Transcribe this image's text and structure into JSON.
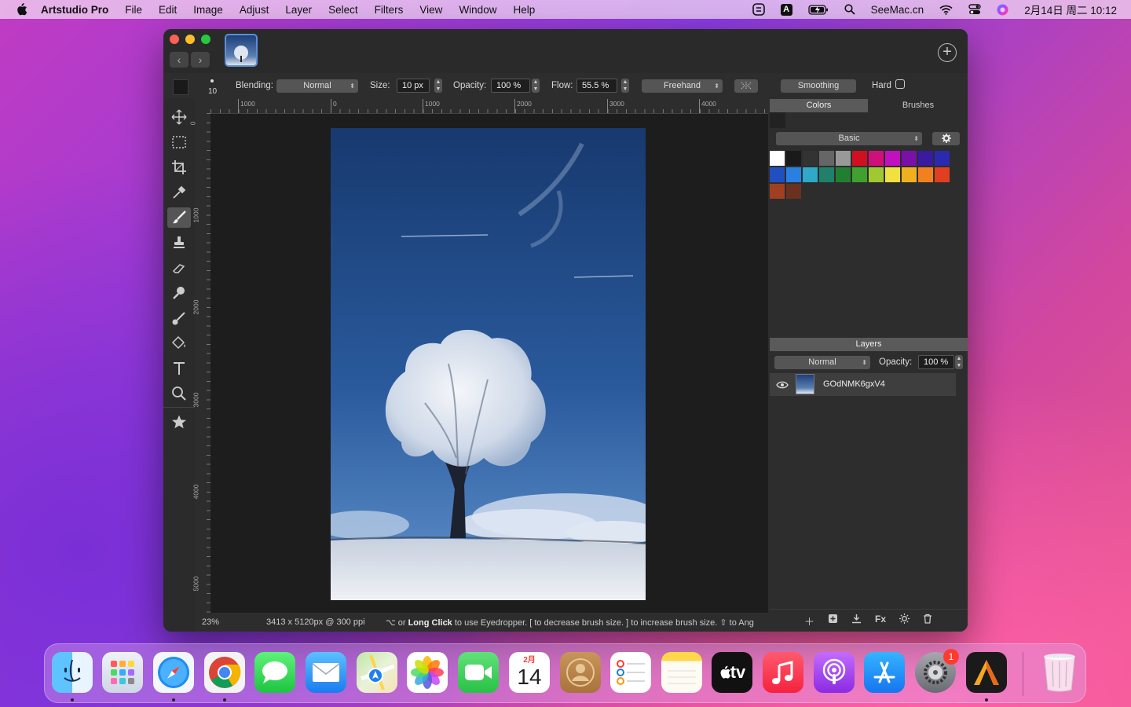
{
  "menubar": {
    "app_name": "Artstudio Pro",
    "items": [
      "File",
      "Edit",
      "Image",
      "Adjust",
      "Layer",
      "Select",
      "Filters",
      "View",
      "Window",
      "Help"
    ],
    "input_indicator": "A",
    "site": "SeeMac.cn",
    "datetime": "2月14日 周二  10:12"
  },
  "options": {
    "brush_size_small": "10",
    "blending_label": "Blending:",
    "blending_value": "Normal",
    "size_label": "Size:",
    "size_value": "10 px",
    "opacity_label": "Opacity:",
    "opacity_value": "100 %",
    "flow_label": "Flow:",
    "flow_value": "55.5 %",
    "mode_value": "Freehand",
    "smoothing_label": "Smoothing",
    "hard_label": "Hard"
  },
  "rulers": {
    "h_labels": [
      "1000",
      "0",
      "1000",
      "2000",
      "3000",
      "4000"
    ],
    "v_labels": [
      "0",
      "1000",
      "2000",
      "3000",
      "4000",
      "5000"
    ]
  },
  "status": {
    "zoom": "23%",
    "dimensions": "3413 x 5120px @ 300 ppi",
    "hint_pre": "⌥ or ",
    "hint_bold": "Long Click",
    "hint_post": " to use Eyedropper.  [ to decrease brush size.  ] to increase brush size.  ⇧ to Ang"
  },
  "panel": {
    "tabs": [
      "Colors",
      "Brushes"
    ],
    "palette_name": "Basic",
    "swatches_row1": [
      "#ffffff",
      "#1a1a1a",
      "#333333",
      "#666666",
      "#999999",
      "#d01020",
      "#d0107a",
      "#c010c0",
      "#7a10a8",
      "#3a1aa0",
      "#2a2ab0"
    ],
    "swatches_row2": [
      "#2050c0",
      "#2a80e0",
      "#30a8c8",
      "#20806a",
      "#208030",
      "#40a030",
      "#a0c830",
      "#f0e040",
      "#f0b020",
      "#f08020",
      "#e04020"
    ],
    "swatches_row3": [
      "#a04020",
      "#6a3020"
    ],
    "layers_title": "Layers",
    "layer_blend": "Normal",
    "layer_opacity_label": "Opacity:",
    "layer_opacity_value": "100 %",
    "layer_name": "GOdNMK6gxV4",
    "fx_label": "Fx"
  },
  "dock": {
    "calendar_month": "2月",
    "calendar_day": "14",
    "tv_label": "tv",
    "settings_badge": "1"
  }
}
